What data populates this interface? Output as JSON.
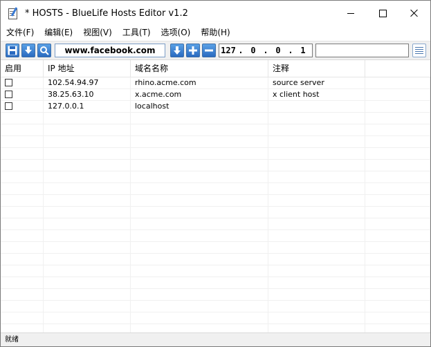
{
  "window": {
    "title": "* HOSTS - BlueLife Hosts Editor v1.2"
  },
  "menu": {
    "items": [
      "文件(F)",
      "编辑(E)",
      "视图(V)",
      "工具(T)",
      "选项(O)",
      "帮助(H)"
    ]
  },
  "toolbar": {
    "domain_value": "www.facebook.com",
    "ip_octets": [
      "127",
      "0",
      "0",
      "1"
    ],
    "comment_value": ""
  },
  "table": {
    "headers": [
      "启用",
      "IP 地址",
      "域名名称",
      "注释"
    ],
    "rows": [
      {
        "ip": "102.54.94.97",
        "domain": "rhino.acme.com",
        "comment": "source server"
      },
      {
        "ip": "38.25.63.10",
        "domain": "x.acme.com",
        "comment": "x client host"
      },
      {
        "ip": "127.0.0.1",
        "domain": "localhost",
        "comment": ""
      }
    ]
  },
  "status": {
    "text": "就绪"
  },
  "icons": [
    "app-icon",
    "save-icon",
    "download-icon",
    "search-icon",
    "arrow-down-icon",
    "plus-icon",
    "minus-icon",
    "list-icon",
    "minimize-icon",
    "maximize-icon",
    "close-icon"
  ]
}
